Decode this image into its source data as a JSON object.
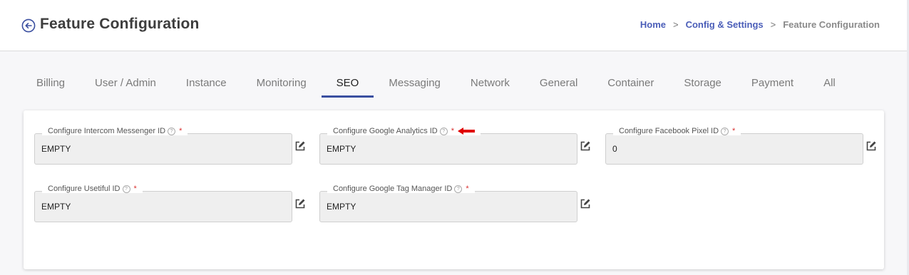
{
  "header": {
    "title": "Feature Configuration",
    "breadcrumb": {
      "home": "Home",
      "separator": ">",
      "config": "Config & Settings",
      "current": "Feature Configuration"
    }
  },
  "tabs": [
    {
      "label": "Billing",
      "active": false
    },
    {
      "label": "User / Admin",
      "active": false
    },
    {
      "label": "Instance",
      "active": false
    },
    {
      "label": "Monitoring",
      "active": false
    },
    {
      "label": "SEO",
      "active": true
    },
    {
      "label": "Messaging",
      "active": false
    },
    {
      "label": "Network",
      "active": false
    },
    {
      "label": "General",
      "active": false
    },
    {
      "label": "Container",
      "active": false
    },
    {
      "label": "Storage",
      "active": false
    },
    {
      "label": "Payment",
      "active": false
    },
    {
      "label": "All",
      "active": false
    }
  ],
  "fields": {
    "intercom": {
      "label": "Configure Intercom Messenger ID",
      "help": "?",
      "required": "*",
      "value": "EMPTY"
    },
    "google_analytics": {
      "label": "Configure Google Analytics ID",
      "help": "?",
      "required": "*",
      "value": "EMPTY"
    },
    "facebook_pixel": {
      "label": "Configure Facebook Pixel ID",
      "help": "?",
      "required": "*",
      "value": "0"
    },
    "usetiful": {
      "label": "Configure Usetiful ID",
      "help": "?",
      "required": "*",
      "value": "EMPTY"
    },
    "google_tag_manager": {
      "label": "Configure Google Tag Manager ID",
      "help": "?",
      "required": "*",
      "value": "EMPTY"
    }
  },
  "colors": {
    "accent": "#3a4fa0",
    "link": "#4a5db8",
    "required": "#d9302f",
    "arrow": "#e00000"
  },
  "icons": [
    "back-arrow-circle-icon",
    "help-circle-icon",
    "edit-icon",
    "red-arrow-icon"
  ]
}
